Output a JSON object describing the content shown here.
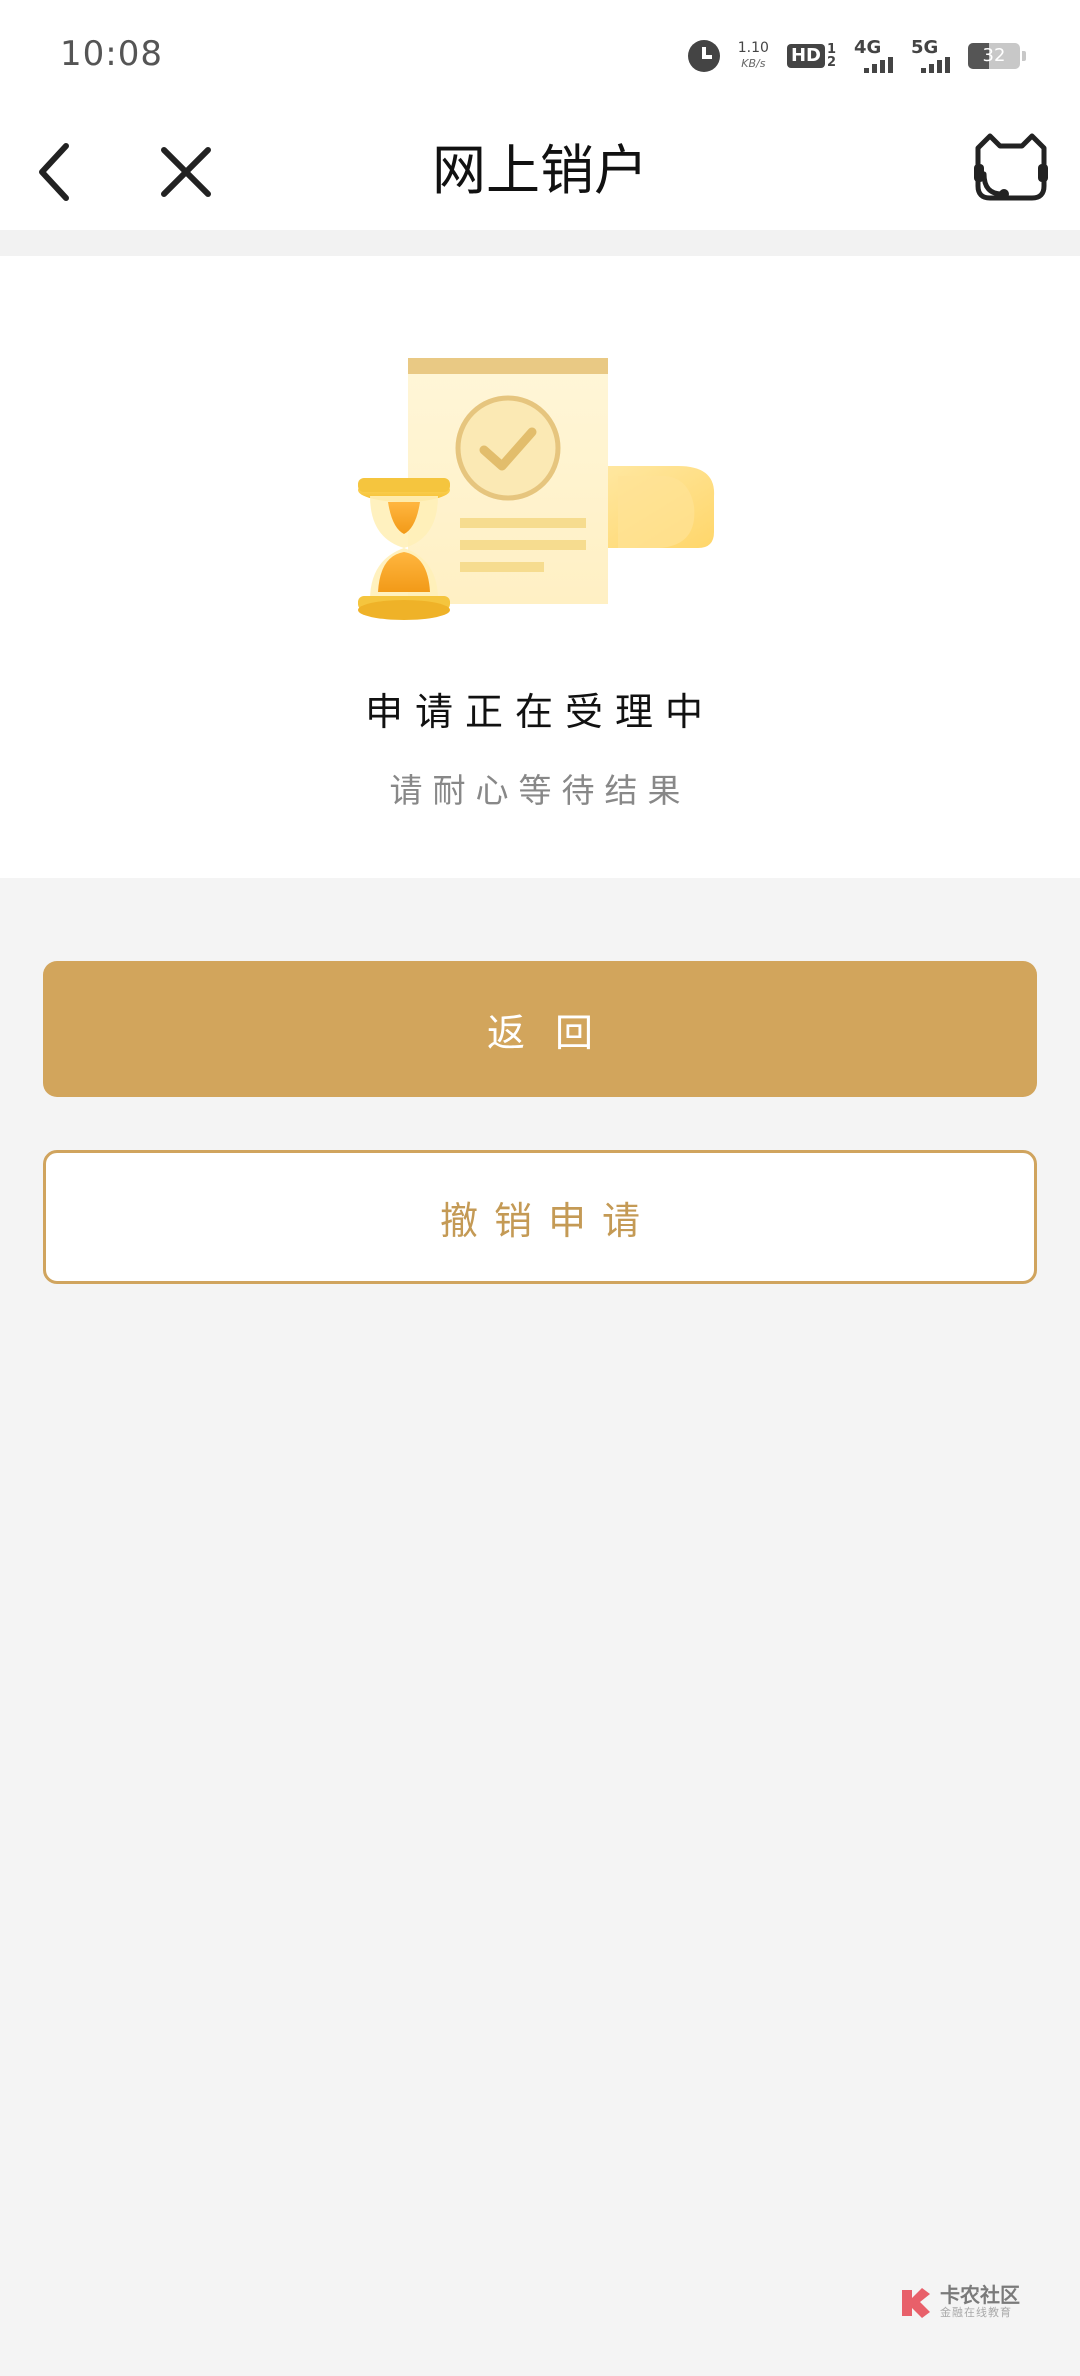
{
  "status_bar": {
    "time": "10:08",
    "net_speed": "1.10",
    "net_speed_unit": "KB/s",
    "hd_label": "HD",
    "hd_sub_top": "1",
    "hd_sub_bottom": "2",
    "network_1": "4G",
    "network_2": "5G",
    "battery_level": "32"
  },
  "nav": {
    "title": "网上销户"
  },
  "status": {
    "title": "申请正在受理中",
    "subtitle": "请耐心等待结果"
  },
  "buttons": {
    "return_label": "返回",
    "cancel_label": "撤销申请"
  },
  "watermark": {
    "brand": "卡农社区",
    "tagline": "金融在线教育"
  },
  "colors": {
    "accent": "#d2a55c",
    "accent_text": "#c49a55",
    "background": "#f4f4f4"
  },
  "icons": {
    "back": "chevron-left-icon",
    "close": "close-icon",
    "service": "customer-service-icon",
    "status": "hourglass-document-icon"
  }
}
